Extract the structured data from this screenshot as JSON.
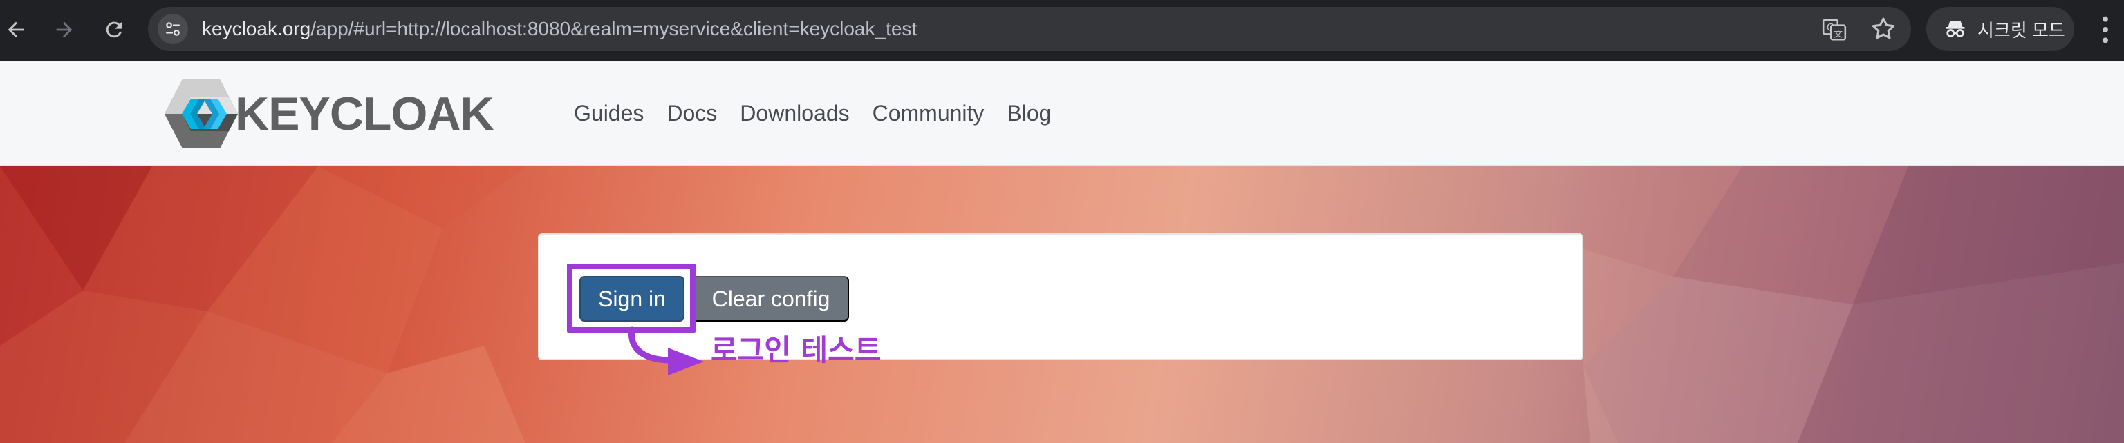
{
  "browser": {
    "url_host": "keycloak.org",
    "url_rest": "/app/#url=http://localhost:8080&realm=myservice&client=keycloak_test",
    "incognito_label": "시크릿 모드",
    "icons": [
      "back-icon",
      "forward-icon",
      "reload-icon",
      "site-info-icon",
      "translate-icon",
      "star-icon",
      "incognito-icon",
      "kebab-menu-icon"
    ]
  },
  "header": {
    "logo_text": "KEYCLOAK",
    "nav": [
      "Guides",
      "Docs",
      "Downloads",
      "Community",
      "Blog"
    ]
  },
  "card": {
    "signin_label": "Sign in",
    "clear_label": "Clear config"
  },
  "annotation": {
    "label": "로그인 테스트",
    "color": "#a23ad6"
  },
  "colors": {
    "chrome_bg": "#202124",
    "primary_button": "#2e6193",
    "secondary_button": "#6c757d",
    "hero_accent": "#d4553d"
  }
}
